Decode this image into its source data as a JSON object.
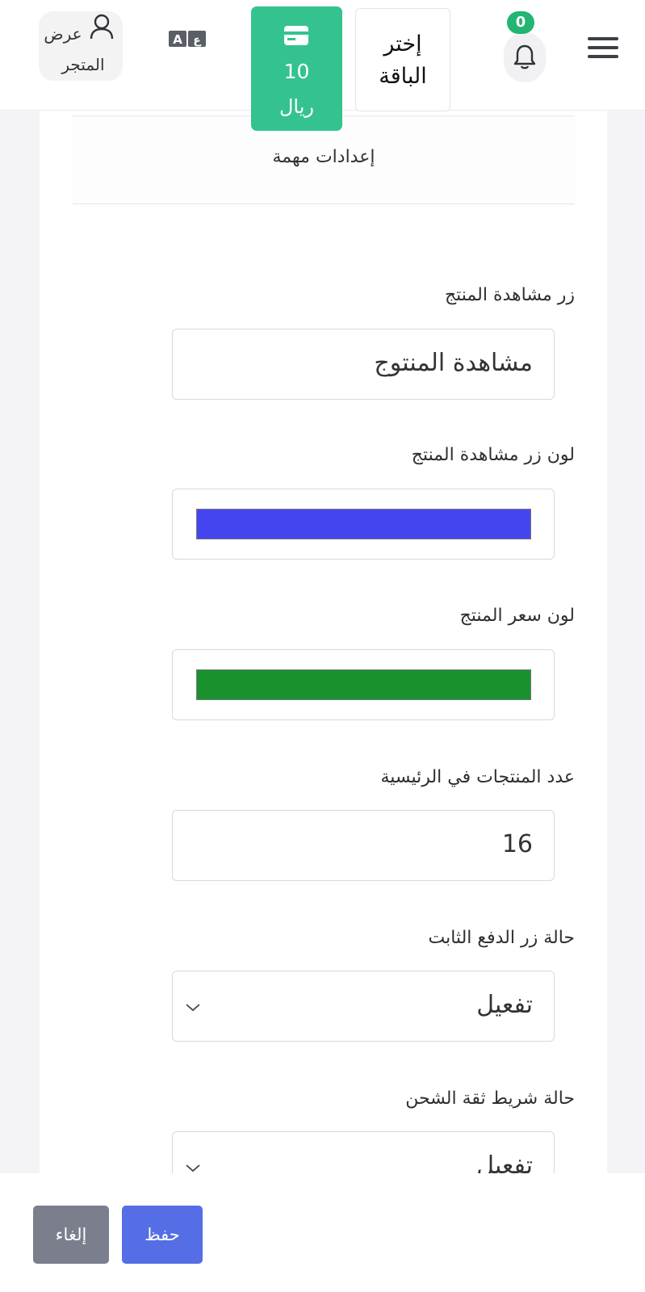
{
  "header": {
    "notification_count": "0",
    "plan_button_label_line1": "إختر",
    "plan_button_label_line2": "الباقة",
    "balance_amount": "10",
    "balance_currency": "ريال",
    "view_store_line1": "عرض",
    "view_store_line2": "المتجر"
  },
  "panel": {
    "title": "إعدادات مهمة"
  },
  "fields": {
    "view_button_text": {
      "label": "زر مشاهدة المنتج",
      "value": "مشاهدة المنتوج"
    },
    "view_button_color": {
      "label": "لون زر مشاهدة المنتج",
      "color": "#4545f0"
    },
    "price_color": {
      "label": "لون سعر المنتج",
      "color": "#19922d"
    },
    "products_count": {
      "label": "عدد المنتجات في الرئيسية",
      "value": "16"
    },
    "fixed_pay_button": {
      "label": "حالة زر الدفع الثابت",
      "value": "تفعيل"
    },
    "shipping_trust_bar": {
      "label": "حالة شريط ثقة الشحن",
      "value": "تفعيل"
    }
  },
  "footer": {
    "save_label": "حفظ",
    "cancel_label": "إلغاء"
  },
  "colors": {
    "accent": "#556ee6",
    "success": "#34c38f",
    "cancel": "#7b7f8d"
  }
}
